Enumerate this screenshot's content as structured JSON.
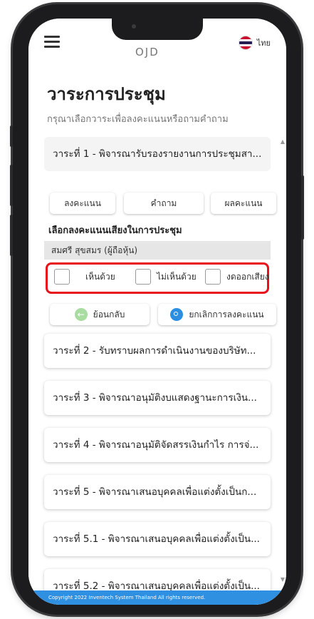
{
  "header": {
    "logo_text": "OJD",
    "language_label": "ไทย",
    "flag_icon": "thailand-flag-icon",
    "menu_icon": "hamburger-menu-icon"
  },
  "page": {
    "title": "วาระการประชุม",
    "subtitle": "กรุณาเลือกวาระเพื่อลงคะแนนหรือถามคำถาม"
  },
  "agendas": [
    {
      "label": "วาระที่ 1 - พิจารณารับรองรายงานการประชุมสา..."
    },
    {
      "label": "วาระที่ 2 - รับทราบผลการดำเนินงานของบริษัท..."
    },
    {
      "label": "วาระที่ 3 - พิจารณาอนุมัติงบแสดงฐานะการเงิน..."
    },
    {
      "label": "วาระที่ 4 - พิจารณาอนุมัติจัดสรรเงินกำไร การจ่..."
    },
    {
      "label": "วาระที่ 5 - พิจารณาเสนอบุคคลเพื่อแต่งตั้งเป็นก..."
    },
    {
      "label": "วาระที่ 5.1 - พิจารณาเสนอบุคคลเพื่อแต่งตั้งเป็น..."
    },
    {
      "label": "วาระที่ 5.2 - พิจารณาเสนอบุคคลเพื่อแต่งตั้งเป็น..."
    }
  ],
  "tabs": {
    "vote": "ลงคะแนน",
    "question": "คำถาม",
    "result": "ผลคะแนน"
  },
  "voting": {
    "section_label": "เลือกลงคะแนนเสียงในการประชุม",
    "voter_name": "สมศรี สุขสมร (ผู้ถือหุ้น)",
    "options": {
      "approve": "เห็นด้วย",
      "disapprove": "ไม่เห็นด้วย",
      "abstain": "งดออกเสียง"
    },
    "highlight_color": "#e8101a"
  },
  "actions": {
    "back": "ย้อนกลับ",
    "cancel_vote": "ยกเลิกการลงคะแนน"
  },
  "footer": {
    "copyright": "Copyright 2022 Inventech System Thailand All rights reserved."
  },
  "colors": {
    "footer_bg": "#2f8fe0",
    "back_icon": "#a8dca0",
    "cancel_icon": "#2a8fe3"
  }
}
